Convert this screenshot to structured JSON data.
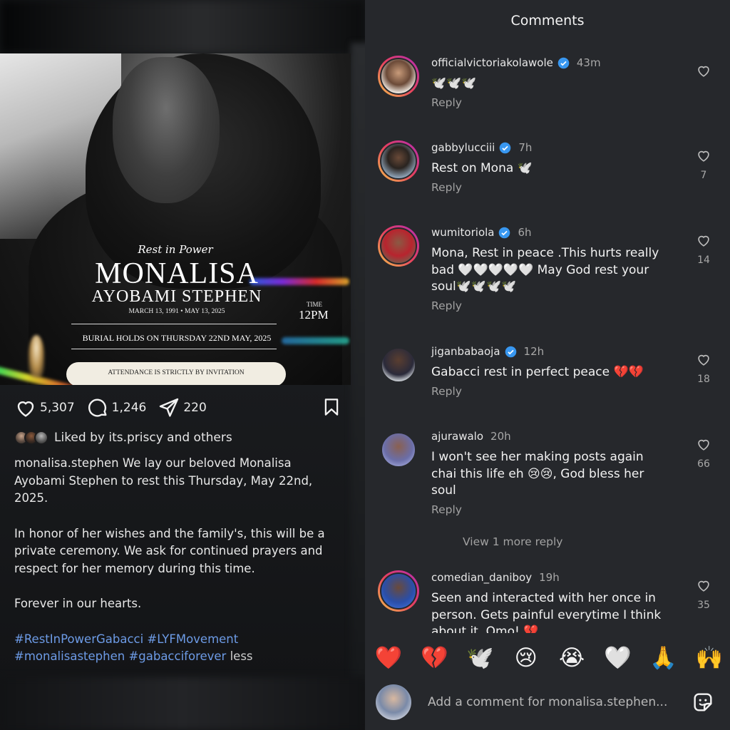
{
  "post": {
    "poster": {
      "script": "Rest in Power",
      "name": "MONALISA",
      "subname": "AYOBAMI STEPHEN",
      "dates": "MARCH 13, 1991 • MAY 13, 2025",
      "time_label": "TIME",
      "time": "12PM",
      "burial": "BURIAL HOLDS ON THURSDAY 22ND MAY, 2025",
      "attendance": "ATTENDANCE IS STRICTLY BY INVITATION"
    },
    "likes": "5,307",
    "comments": "1,246",
    "shares": "220",
    "liked_by": "Liked by its.priscy and others",
    "caption": {
      "p1": "monalisa.stephen We lay our beloved Monalisa Ayobami Stephen to rest this Thursday, May 22nd, 2025.",
      "p2": "In honor of her wishes and the family's, this will be a private ceremony. We ask for continued prayers and respect for her memory during this time.",
      "p3": "Forever in our hearts.",
      "hashtags1": "#RestInPowerGabacci #LYFMovement",
      "hashtags2": "#monalisastephen #gabacciforever",
      "less": "less"
    }
  },
  "comments_panel": {
    "title": "Comments",
    "reply_label": "Reply",
    "view_more": "View 1 more reply",
    "items": [
      {
        "user": "officialvictoriakolawole",
        "time": "43m",
        "text": "🕊️🕊️🕊️",
        "likes": ""
      },
      {
        "user": "gabbylucciii",
        "time": "7h",
        "text": "Rest on Mona 🕊️",
        "likes": "7"
      },
      {
        "user": "wumitoriola",
        "time": "6h",
        "text": "Mona, Rest in peace .This hurts really bad 🤍🤍🤍🤍🤍 May God rest your soul🕊️🕊️🕊️🕊️",
        "likes": "14"
      },
      {
        "user": "jiganbabaoja",
        "time": "12h",
        "text": "Gabacci rest in perfect peace 💔💔",
        "likes": "18"
      },
      {
        "user": "ajurawalo",
        "time": "20h",
        "text": "I won't see her making posts again chai this life eh 😢😢, God bless her soul",
        "likes": "66"
      },
      {
        "user": "comedian_daniboy",
        "time": "19h",
        "text": "Seen and interacted with her once in person. Gets painful everytime I think about it. Omo! 💔",
        "likes": "35"
      }
    ],
    "emojis": [
      "❤️",
      "💔",
      "🕊️",
      "😢",
      "😭",
      "🤍",
      "🙏",
      "🙌"
    ],
    "composer_placeholder": "Add a comment for monalisa.stephen..."
  }
}
